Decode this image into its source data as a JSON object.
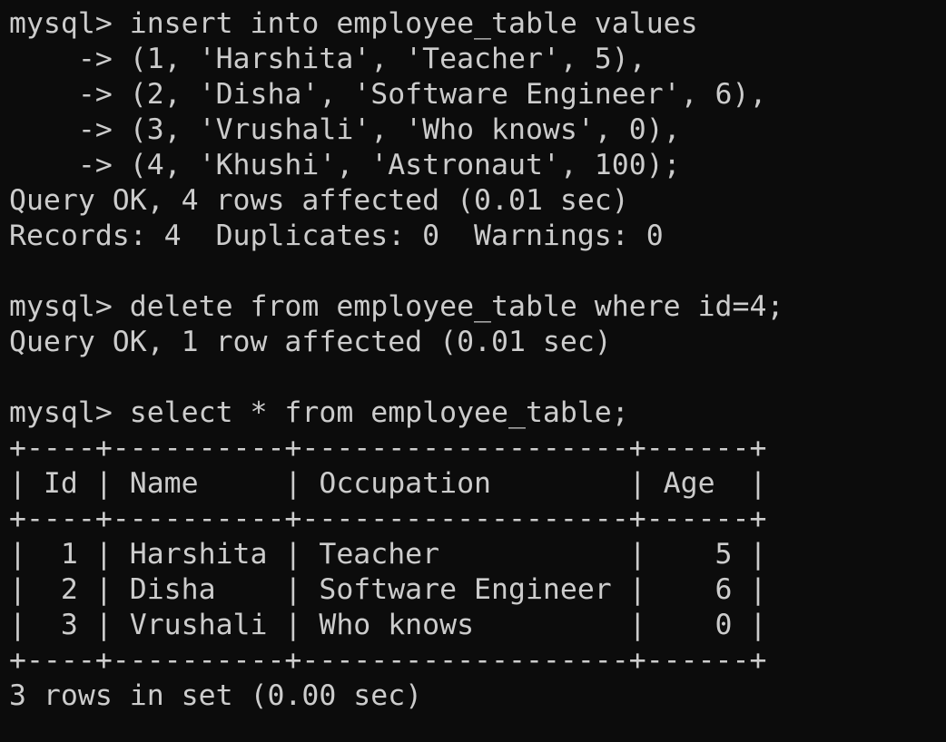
{
  "terminal": {
    "lines": [
      "mysql> insert into employee_table values",
      "    -> (1, 'Harshita', 'Teacher', 5),",
      "    -> (2, 'Disha', 'Software Engineer', 6),",
      "    -> (3, 'Vrushali', 'Who knows', 0),",
      "    -> (4, 'Khushi', 'Astronaut', 100);",
      "Query OK, 4 rows affected (0.01 sec)",
      "Records: 4  Duplicates: 0  Warnings: 0",
      "",
      "mysql> delete from employee_table where id=4;",
      "Query OK, 1 row affected (0.01 sec)",
      "",
      "mysql> select * from employee_table;",
      "+----+----------+-------------------+------+",
      "| Id | Name     | Occupation        | Age  |",
      "+----+----------+-------------------+------+",
      "|  1 | Harshita | Teacher           |    5 |",
      "|  2 | Disha    | Software Engineer |    6 |",
      "|  3 | Vrushali | Who knows         |    0 |",
      "+----+----------+-------------------+------+",
      "3 rows in set (0.00 sec)"
    ]
  },
  "colors": {
    "background": "#0c0c0c",
    "text": "#cccccc"
  }
}
